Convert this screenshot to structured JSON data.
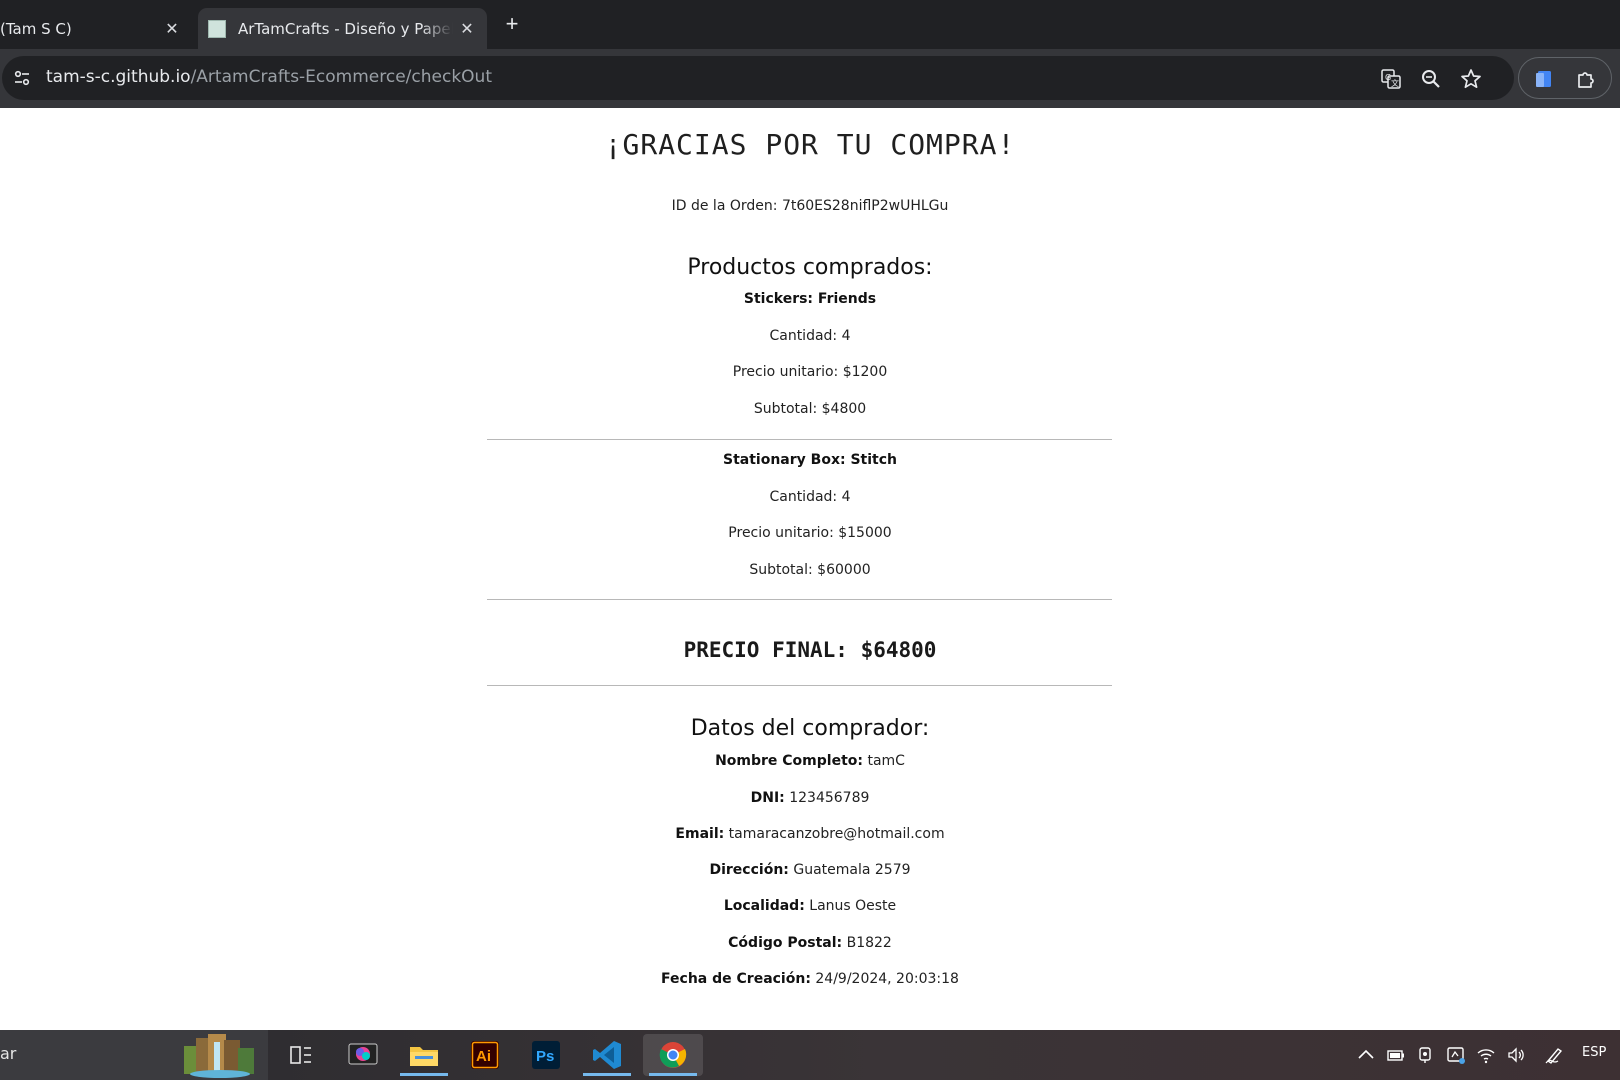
{
  "browser": {
    "tabs": [
      {
        "title": "(Tam S C)",
        "active": false
      },
      {
        "title": "ArTamCrafts - Diseño y Papelería",
        "active": true
      }
    ],
    "url_host": "tam-s-c.github.io",
    "url_path": "/ArtamCrafts-Ecommerce/checkOut"
  },
  "page": {
    "title": "¡GRACIAS POR TU COMPRA!",
    "order_id_label": "ID de la Orden:",
    "order_id": "7t60ES28niflP2wUHLGu",
    "products_heading": "Productos comprados:",
    "products": [
      {
        "name": "Stickers: Friends",
        "qty_line": "Cantidad: 4",
        "price_line": "Precio unitario: $1200",
        "subtotal_line": "Subtotal: $4800"
      },
      {
        "name": "Stationary Box: Stitch",
        "qty_line": "Cantidad: 4",
        "price_line": "Precio unitario: $15000",
        "subtotal_line": "Subtotal: $60000"
      }
    ],
    "final_price": "PRECIO FINAL: $64800",
    "buyer_heading": "Datos del comprador:",
    "buyer": [
      {
        "label": "Nombre Completo:",
        "value": "tamC"
      },
      {
        "label": "DNI:",
        "value": "123456789"
      },
      {
        "label": "Email:",
        "value": "tamaracanzobre@hotmail.com"
      },
      {
        "label": "Dirección:",
        "value": "Guatemala 2579"
      },
      {
        "label": "Localidad:",
        "value": "Lanus Oeste"
      },
      {
        "label": "Código Postal:",
        "value": "B1822"
      },
      {
        "label": "Fecha de Creación:",
        "value": "24/9/2024, 20:03:18"
      }
    ]
  },
  "taskbar": {
    "search_text": "ar",
    "apps": [
      "task-view-icon",
      "photo-app-icon",
      "file-explorer-icon",
      "illustrator-icon",
      "photoshop-icon",
      "vscode-icon",
      "chrome-icon"
    ],
    "illustrator_label": "Ai",
    "photoshop_label": "Ps",
    "language": "ESP"
  },
  "colors": {
    "chrome_dark": "#202124",
    "chrome_toolbar": "#35363a",
    "page_bg": "#ffffff",
    "text": "#1f1f1f"
  }
}
